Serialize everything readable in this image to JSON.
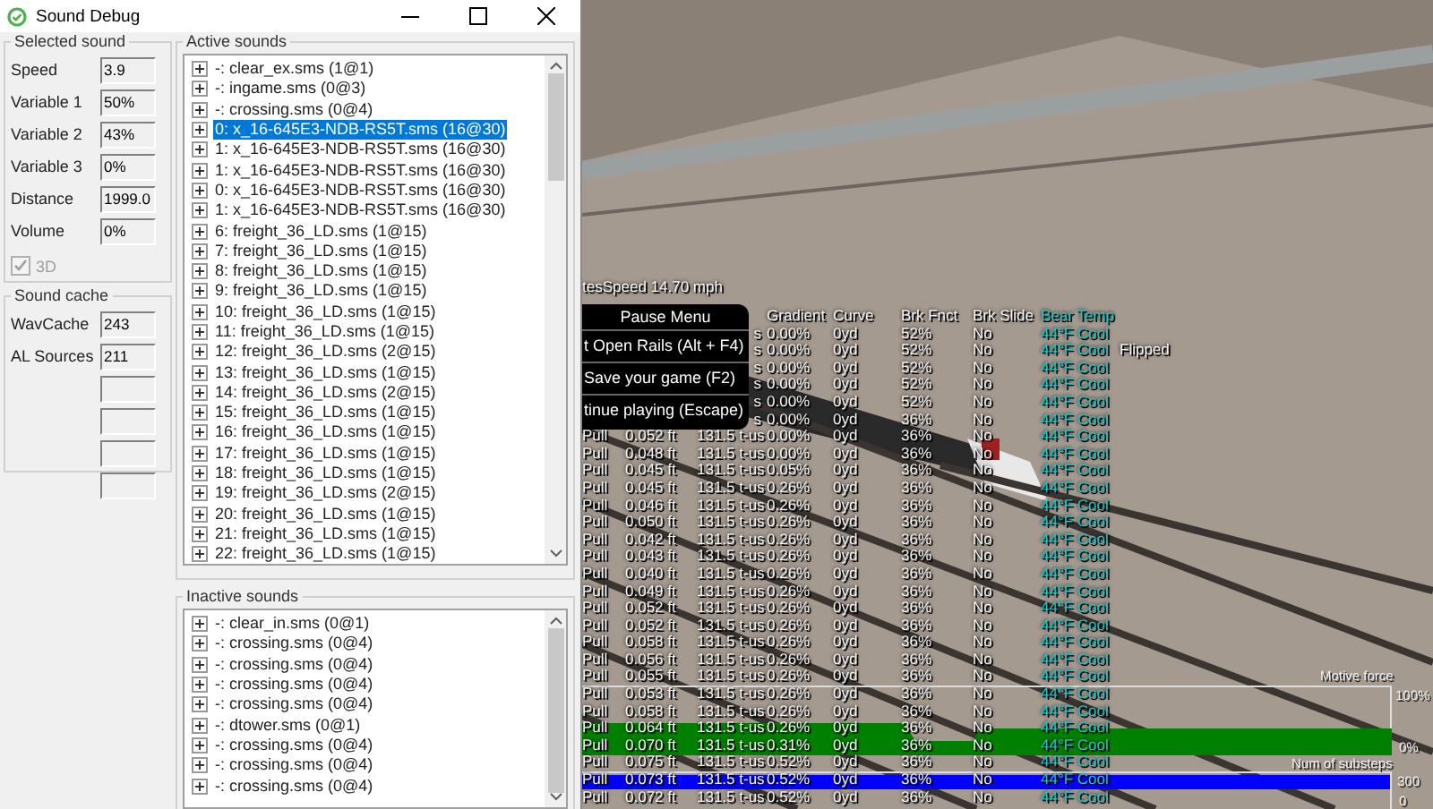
{
  "sound_debug_window": {
    "title": "Sound Debug",
    "selected_sound": {
      "title": "Selected sound",
      "fields": [
        {
          "label": "Speed",
          "value": "3.9"
        },
        {
          "label": "Variable 1",
          "value": "50%"
        },
        {
          "label": "Variable 2",
          "value": "43%"
        },
        {
          "label": "Variable 3",
          "value": "0%"
        },
        {
          "label": "Distance",
          "value": "1999.0"
        },
        {
          "label": "Volume",
          "value": "0%"
        }
      ],
      "checkbox": {
        "label": "3D",
        "checked": true,
        "disabled": true
      }
    },
    "sound_cache": {
      "title": "Sound cache",
      "fields": [
        {
          "kind": "value",
          "label": "WavCache",
          "value": "243"
        },
        {
          "kind": "value",
          "label": "AL Sources",
          "value": "211"
        },
        {
          "kind": "blank"
        },
        {
          "kind": "blank"
        },
        {
          "kind": "blank"
        },
        {
          "kind": "blank"
        }
      ]
    },
    "active_sounds": {
      "title": "Active sounds",
      "items": [
        {
          "label": "-: clear_ex.sms (1@1)",
          "selected": false
        },
        {
          "label": "-: ingame.sms (0@3)",
          "selected": false
        },
        {
          "label": "-: crossing.sms (0@4)",
          "selected": false
        },
        {
          "label": "0: x_16-645E3-NDB-RS5T.sms (16@30)",
          "selected": true
        },
        {
          "label": "1: x_16-645E3-NDB-RS5T.sms (16@30)",
          "selected": false
        },
        {
          "label": "1: x_16-645E3-NDB-RS5T.sms (16@30)",
          "selected": false
        },
        {
          "label": "0: x_16-645E3-NDB-RS5T.sms (16@30)",
          "selected": false
        },
        {
          "label": "1: x_16-645E3-NDB-RS5T.sms (16@30)",
          "selected": false
        },
        {
          "label": "6: freight_36_LD.sms (1@15)",
          "selected": false
        },
        {
          "label": "7: freight_36_LD.sms (1@15)",
          "selected": false
        },
        {
          "label": "8: freight_36_LD.sms (1@15)",
          "selected": false
        },
        {
          "label": "9: freight_36_LD.sms (1@15)",
          "selected": false
        },
        {
          "label": "10: freight_36_LD.sms (1@15)",
          "selected": false
        },
        {
          "label": "11: freight_36_LD.sms (1@15)",
          "selected": false
        },
        {
          "label": "12: freight_36_LD.sms (2@15)",
          "selected": false
        },
        {
          "label": "13: freight_36_LD.sms (1@15)",
          "selected": false
        },
        {
          "label": "14: freight_36_LD.sms (2@15)",
          "selected": false
        },
        {
          "label": "15: freight_36_LD.sms (1@15)",
          "selected": false
        },
        {
          "label": "16: freight_36_LD.sms (1@15)",
          "selected": false
        },
        {
          "label": "17: freight_36_LD.sms (1@15)",
          "selected": false
        },
        {
          "label": "18: freight_36_LD.sms (1@15)",
          "selected": false
        },
        {
          "label": "19: freight_36_LD.sms (2@15)",
          "selected": false
        },
        {
          "label": "20: freight_36_LD.sms (1@15)",
          "selected": false
        },
        {
          "label": "21: freight_36_LD.sms (1@15)",
          "selected": false
        },
        {
          "label": "22: freight_36_LD.sms (1@15)",
          "selected": false
        }
      ]
    },
    "inactive_sounds": {
      "title": "Inactive sounds",
      "items": [
        {
          "label": "-: clear_in.sms (0@1)",
          "selected": false
        },
        {
          "label": "-: crossing.sms (0@4)",
          "selected": false
        },
        {
          "label": "-: crossing.sms (0@4)",
          "selected": false
        },
        {
          "label": "-: crossing.sms (0@4)",
          "selected": false
        },
        {
          "label": "-: crossing.sms (0@4)",
          "selected": false
        },
        {
          "label": "-: dtower.sms (0@1)",
          "selected": false
        },
        {
          "label": "-: crossing.sms (0@4)",
          "selected": false
        },
        {
          "label": "-: crossing.sms (0@4)",
          "selected": false
        },
        {
          "label": "-: crossing.sms (0@4)",
          "selected": false
        }
      ]
    }
  },
  "game_view": {
    "speed_text": "tesSpeed 14.70 mph",
    "hud_header": {
      "gradient": "Gradient",
      "curve": "Curve",
      "brk_fnct": "Brk Fnct",
      "brk_slide": "Brk Slide",
      "bear_temp": "Bear Temp"
    },
    "hud_rows": [
      {
        "column_3": "s",
        "gradient": "0.00%",
        "curve": "0yd",
        "brk_fnct": "52%",
        "brk_slide": "No",
        "bear_temp": "44°F Cool"
      },
      {
        "column_3": "s",
        "gradient": "0.00%",
        "curve": "0yd",
        "brk_fnct": "52%",
        "brk_slide": "No",
        "bear_temp": "44°F Cool",
        "column_9": "Flipped"
      },
      {
        "column_3": "s",
        "gradient": "0.00%",
        "curve": "0yd",
        "brk_fnct": "52%",
        "brk_slide": "No",
        "bear_temp": "44°F Cool"
      },
      {
        "column_3": "s",
        "gradient": "0.00%",
        "curve": "0yd",
        "brk_fnct": "52%",
        "brk_slide": "No",
        "bear_temp": "44°F Cool"
      },
      {
        "column_3": "s",
        "gradient": "0.00%",
        "curve": "0yd",
        "brk_fnct": "52%",
        "brk_slide": "No",
        "bear_temp": "44°F Cool"
      },
      {
        "column_3": "s",
        "gradient": "0.00%",
        "curve": "0yd",
        "brk_fnct": "36%",
        "brk_slide": "No",
        "bear_temp": "44°F Cool"
      },
      {
        "column_1": "Pull",
        "column_2": "0.052 ft",
        "column_3": "131.5 t-us",
        "gradient": "0.00%",
        "curve": "0yd",
        "brk_fnct": "36%",
        "brk_slide": "No",
        "bear_temp": "44°F Cool"
      },
      {
        "column_1": "Pull",
        "column_2": "0.048 ft",
        "column_3": "131.5 t-us",
        "gradient": "0.00%",
        "curve": "0yd",
        "brk_fnct": "36%",
        "brk_slide": "No",
        "bear_temp": "44°F Cool"
      },
      {
        "column_1": "Pull",
        "column_2": "0.045 ft",
        "column_3": "131.5 t-us",
        "gradient": "0.05%",
        "curve": "0yd",
        "brk_fnct": "36%",
        "brk_slide": "No",
        "bear_temp": "44°F Cool"
      },
      {
        "column_1": "Pull",
        "column_2": "0.045 ft",
        "column_3": "131.5 t-us",
        "gradient": "0.26%",
        "curve": "0yd",
        "brk_fnct": "36%",
        "brk_slide": "No",
        "bear_temp": "44°F Cool"
      },
      {
        "column_1": "Pull",
        "column_2": "0.046 ft",
        "column_3": "131.5 t-us",
        "gradient": "0.26%",
        "curve": "0yd",
        "brk_fnct": "36%",
        "brk_slide": "No",
        "bear_temp": "44°F Cool"
      },
      {
        "column_1": "Pull",
        "column_2": "0.050 ft",
        "column_3": "131.5 t-us",
        "gradient": "0.26%",
        "curve": "0yd",
        "brk_fnct": "36%",
        "brk_slide": "No",
        "bear_temp": "44°F Cool"
      },
      {
        "column_1": "Pull",
        "column_2": "0.042 ft",
        "column_3": "131.5 t-us",
        "gradient": "0.26%",
        "curve": "0yd",
        "brk_fnct": "36%",
        "brk_slide": "No",
        "bear_temp": "44°F Cool"
      },
      {
        "column_1": "Pull",
        "column_2": "0.043 ft",
        "column_3": "131.5 t-us",
        "gradient": "0.26%",
        "curve": "0yd",
        "brk_fnct": "36%",
        "brk_slide": "No",
        "bear_temp": "44°F Cool"
      },
      {
        "column_1": "Pull",
        "column_2": "0.040 ft",
        "column_3": "131.5 t-us",
        "gradient": "0.26%",
        "curve": "0yd",
        "brk_fnct": "36%",
        "brk_slide": "No",
        "bear_temp": "44°F Cool"
      },
      {
        "column_1": "Pull",
        "column_2": "0.049 ft",
        "column_3": "131.5 t-us",
        "gradient": "0.26%",
        "curve": "0yd",
        "brk_fnct": "36%",
        "brk_slide": "No",
        "bear_temp": "44°F Cool"
      },
      {
        "column_1": "Pull",
        "column_2": "0.052 ft",
        "column_3": "131.5 t-us",
        "gradient": "0.26%",
        "curve": "0yd",
        "brk_fnct": "36%",
        "brk_slide": "No",
        "bear_temp": "44°F Cool"
      },
      {
        "column_1": "Pull",
        "column_2": "0.052 ft",
        "column_3": "131.5 t-us",
        "gradient": "0.26%",
        "curve": "0yd",
        "brk_fnct": "36%",
        "brk_slide": "No",
        "bear_temp": "44°F Cool"
      },
      {
        "column_1": "Pull",
        "column_2": "0.058 ft",
        "column_3": "131.5 t-us",
        "gradient": "0.26%",
        "curve": "0yd",
        "brk_fnct": "36%",
        "brk_slide": "No",
        "bear_temp": "44°F Cool"
      },
      {
        "column_1": "Pull",
        "column_2": "0.056 ft",
        "column_3": "131.5 t-us",
        "gradient": "0.26%",
        "curve": "0yd",
        "brk_fnct": "36%",
        "brk_slide": "No",
        "bear_temp": "44°F Cool"
      },
      {
        "column_1": "Pull",
        "column_2": "0.055 ft",
        "column_3": "131.5 t-us",
        "gradient": "0.26%",
        "curve": "0yd",
        "brk_fnct": "36%",
        "brk_slide": "No",
        "bear_temp": "44°F Cool"
      },
      {
        "column_1": "Pull",
        "column_2": "0.053 ft",
        "column_3": "131.5 t-us",
        "gradient": "0.26%",
        "curve": "0yd",
        "brk_fnct": "36%",
        "brk_slide": "No",
        "bear_temp": "44°F Cool"
      },
      {
        "column_1": "Pull",
        "column_2": "0.058 ft",
        "column_3": "131.5 t-us",
        "gradient": "0.26%",
        "curve": "0yd",
        "brk_fnct": "36%",
        "brk_slide": "No",
        "bear_temp": "44°F Cool"
      },
      {
        "column_1": "Pull",
        "column_2": "0.064 ft",
        "column_3": "131.5 t-us",
        "gradient": "0.26%",
        "curve": "0yd",
        "brk_fnct": "36%",
        "brk_slide": "No",
        "bear_temp": "44°F Cool"
      },
      {
        "column_1": "Pull",
        "column_2": "0.070 ft",
        "column_3": "131.5 t-us",
        "gradient": "0.31%",
        "curve": "0yd",
        "brk_fnct": "36%",
        "brk_slide": "No",
        "bear_temp": "44°F Cool"
      },
      {
        "column_1": "Pull",
        "column_2": "0.075 ft",
        "column_3": "131.5 t-us",
        "gradient": "0.52%",
        "curve": "0yd",
        "brk_fnct": "36%",
        "brk_slide": "No",
        "bear_temp": "44°F Cool"
      },
      {
        "column_1": "Pull",
        "column_2": "0.073 ft",
        "column_3": "131.5 t-us",
        "gradient": "0.52%",
        "curve": "0yd",
        "brk_fnct": "36%",
        "brk_slide": "No",
        "bear_temp": "44°F Cool"
      },
      {
        "column_1": "Pull",
        "column_2": "0.072 ft",
        "column_3": "131.5 t-us",
        "gradient": "0.52%",
        "curve": "0yd",
        "brk_fnct": "36%",
        "brk_slide": "No",
        "bear_temp": "44°F Cool"
      }
    ],
    "pause_menu": {
      "title": "Pause Menu",
      "items": [
        "t Open Rails (Alt + F4)",
        "Save your game (F2)",
        "tinue playing (Escape)"
      ]
    },
    "motive_force_graph": {
      "title": "Motive force",
      "top_label": "100%",
      "bottom_label": "0%"
    },
    "substeps_graph": {
      "title": "Num of substeps",
      "top_label": "300",
      "bottom_label": "0"
    }
  }
}
